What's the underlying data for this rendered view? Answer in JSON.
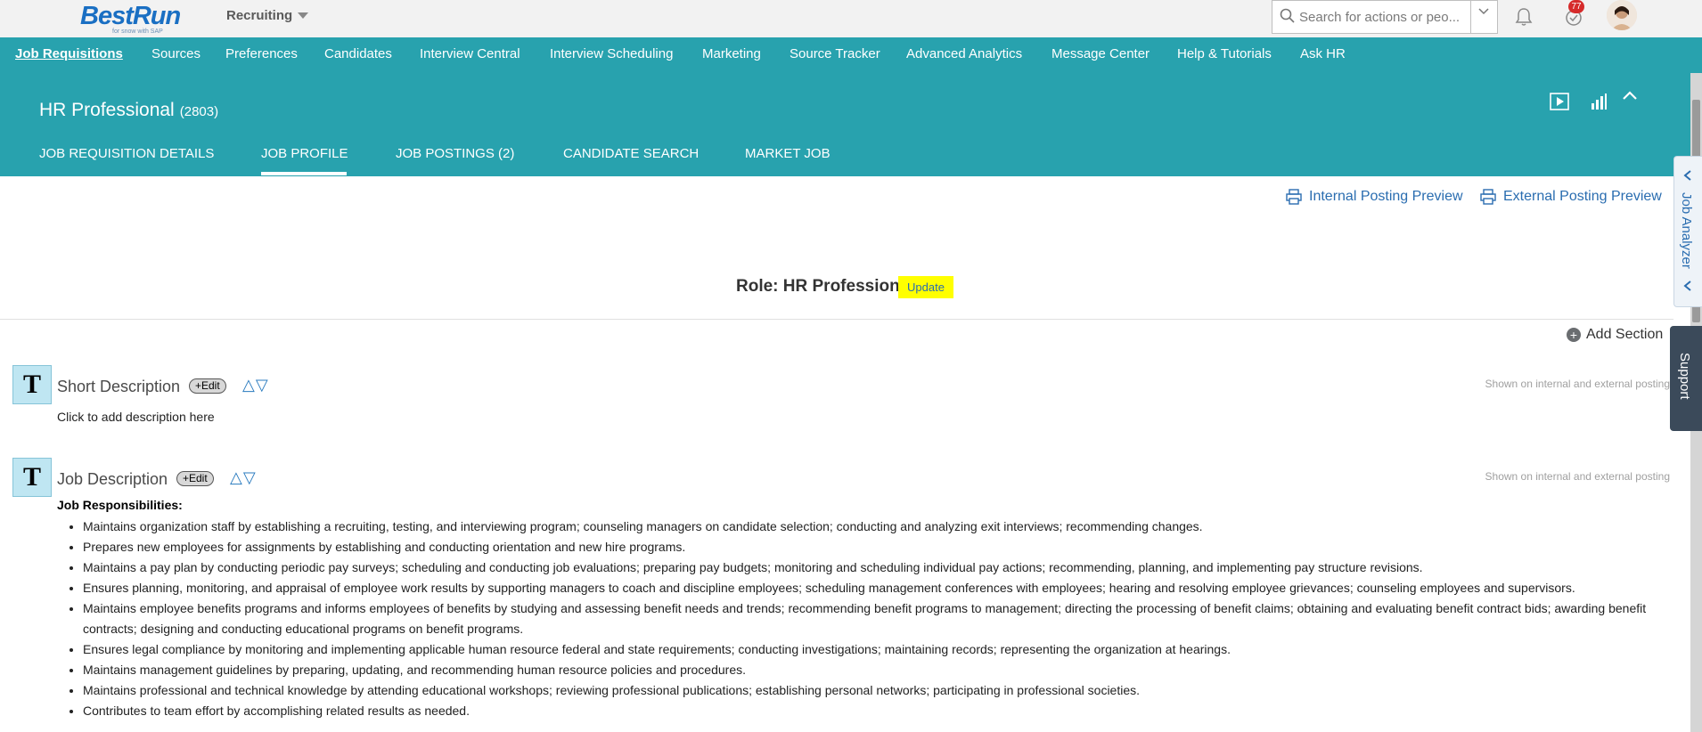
{
  "shell": {
    "logo_text": "BestRun",
    "logo_sub": "for snow with SAP",
    "module": "Recruiting",
    "search_placeholder": "Search for actions or peo...",
    "notification_count": "77"
  },
  "nav": {
    "items": [
      {
        "label": "Job Requisitions"
      },
      {
        "label": "Sources"
      },
      {
        "label": "Preferences"
      },
      {
        "label": "Candidates"
      },
      {
        "label": "Interview Central"
      },
      {
        "label": "Interview Scheduling"
      },
      {
        "label": "Marketing"
      },
      {
        "label": "Source Tracker"
      },
      {
        "label": "Advanced Analytics"
      },
      {
        "label": "Message Center"
      },
      {
        "label": "Help & Tutorials"
      },
      {
        "label": "Ask HR"
      }
    ]
  },
  "header": {
    "title": "HR Professional",
    "req_id": "(2803)",
    "tabs": [
      {
        "label": "JOB REQUISITION DETAILS"
      },
      {
        "label": "JOB PROFILE"
      },
      {
        "label": "JOB POSTINGS (2)"
      },
      {
        "label": "CANDIDATE SEARCH"
      },
      {
        "label": "MARKET JOB"
      }
    ]
  },
  "side": {
    "analyzer": "Job Analyzer",
    "support": "Support"
  },
  "content": {
    "internal_preview": "Internal Posting Preview",
    "external_preview": "External Posting Preview",
    "role": "Role: HR Professional",
    "update": "Update",
    "add_section": "Add Section",
    "sections": [
      {
        "title": "Short Description",
        "edit": "+Edit",
        "shown": "Shown on internal and external posting",
        "placeholder": "Click to add description here"
      },
      {
        "title": "Job Description",
        "edit": "+Edit",
        "shown": "Shown on internal and external posting"
      }
    ],
    "responsibilities_heading": "Job Responsibilities:",
    "responsibilities": [
      "Maintains organization staff by establishing a recruiting, testing, and interviewing program; counseling managers on candidate selection; conducting and analyzing exit interviews; recommending changes.",
      "Prepares new employees for assignments by establishing and conducting orientation and new hire programs.",
      "Maintains a pay plan by conducting periodic pay surveys; scheduling and conducting job evaluations; preparing pay budgets; monitoring and scheduling individual pay actions; recommending, planning, and implementing pay structure revisions.",
      "Ensures planning, monitoring, and appraisal of employee work results by supporting managers to coach and discipline employees; scheduling management conferences with employees; hearing and resolving employee grievances; counseling employees and supervisors.",
      "Maintains employee benefits programs and informs employees of benefits by studying and assessing benefit needs and trends; recommending benefit programs to management; directing the processing of benefit claims; obtaining and evaluating benefit contract bids; awarding benefit contracts; designing and conducting educational programs on benefit programs.",
      "Ensures legal compliance by monitoring and implementing applicable human resource federal and state requirements; conducting investigations; maintaining records; representing the organization at hearings.",
      "Maintains management guidelines by preparing, updating, and recommending human resource policies and procedures.",
      "Maintains professional and technical knowledge by attending educational workshops; reviewing professional publications; establishing personal networks; participating in professional societies.",
      "Contributes to team effort by accomplishing related results as needed."
    ]
  }
}
